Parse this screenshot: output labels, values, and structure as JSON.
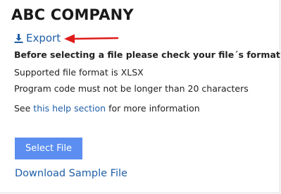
{
  "header": {
    "title": "ABC COMPANY"
  },
  "export": {
    "label": "Export",
    "icon": "download-icon"
  },
  "annotation": {
    "icon": "red-arrow-left-icon",
    "color": "#e01b1b"
  },
  "instructions": {
    "heading": "Before selecting a file please check your file´s format:",
    "format_line": "Supported file format is XLSX",
    "code_line": "Program code must not be longer than 20 characters",
    "help_prefix": "See ",
    "help_link": "this help section",
    "help_suffix": " for more information"
  },
  "actions": {
    "select_file": "Select File",
    "download_sample": "Download Sample File"
  },
  "colors": {
    "link": "#1f5fa8",
    "button_bg": "#5b8ef0",
    "button_text": "#ffffff"
  }
}
